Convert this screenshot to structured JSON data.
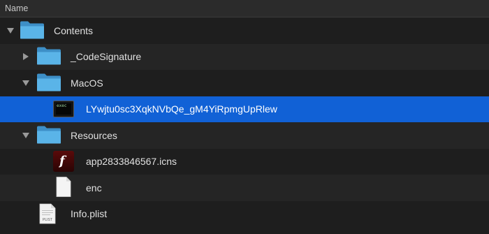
{
  "header": {
    "column_name": "Name"
  },
  "rows": [
    {
      "name": "Contents",
      "kind": "folder",
      "expanded": true,
      "depth": 0,
      "selected": false,
      "disclosure_icon": "chevron-down-icon"
    },
    {
      "name": "_CodeSignature",
      "kind": "folder",
      "expanded": false,
      "depth": 1,
      "selected": false,
      "disclosure_icon": "chevron-right-icon"
    },
    {
      "name": "MacOS",
      "kind": "folder",
      "expanded": true,
      "depth": 1,
      "selected": false,
      "disclosure_icon": "chevron-down-icon"
    },
    {
      "name": "LYwjtu0sc3XqkNVbQe_gM4YiRpmgUpRlew",
      "kind": "executable",
      "depth": 2,
      "selected": true,
      "file_icon": "terminal-executable-icon"
    },
    {
      "name": "Resources",
      "kind": "folder",
      "expanded": true,
      "depth": 1,
      "selected": false,
      "disclosure_icon": "chevron-down-icon"
    },
    {
      "name": "app2833846567.icns",
      "kind": "icns",
      "depth": 2,
      "selected": false,
      "file_icon": "flash-icns-icon"
    },
    {
      "name": "enc",
      "kind": "document",
      "depth": 2,
      "selected": false,
      "file_icon": "blank-document-icon"
    },
    {
      "name": "Info.plist",
      "kind": "plist",
      "depth": 1,
      "selected": false,
      "file_icon": "plist-document-icon",
      "icon_badge": "PLIST"
    }
  ],
  "colors": {
    "background": "#1e1e1e",
    "alt_row": "#252525",
    "selection": "#1161d6",
    "folder": "#5ab4e8"
  }
}
